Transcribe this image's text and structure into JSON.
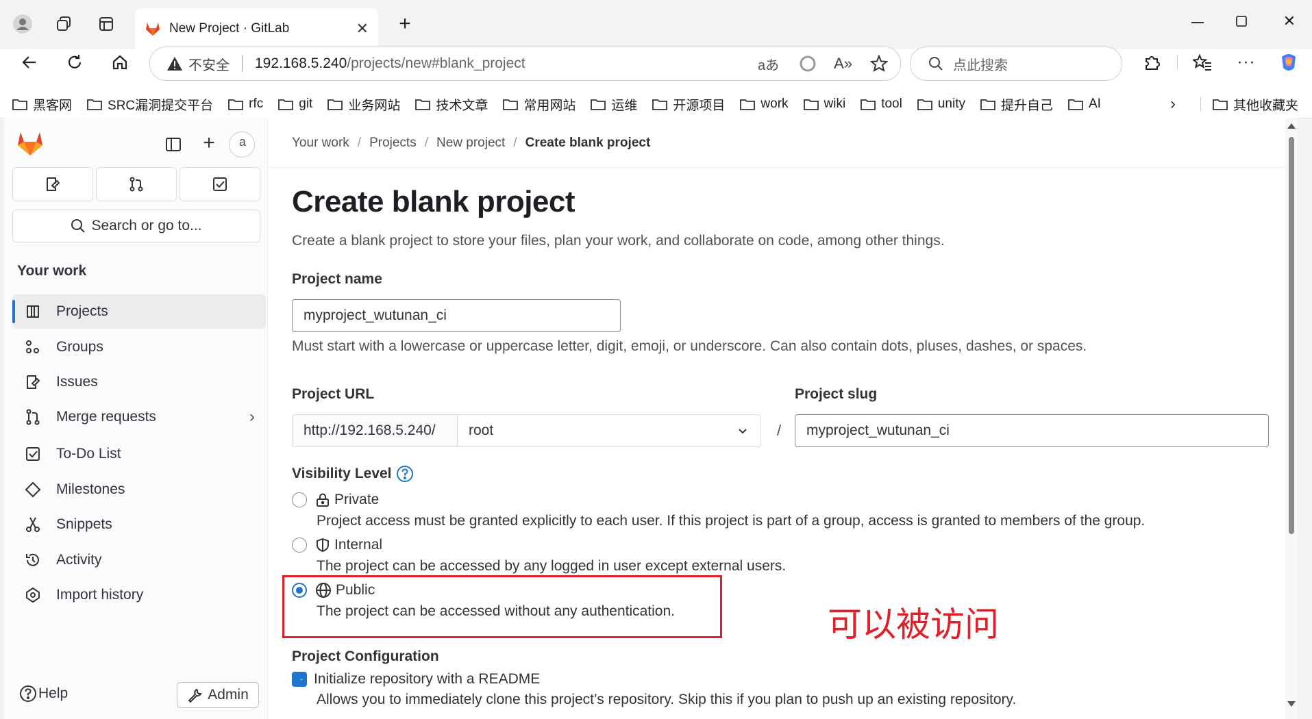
{
  "browser": {
    "tab_title": "New Project · GitLab",
    "insecure_label": "不安全",
    "url_host": "192.168.5.240",
    "url_path": "/projects/new#blank_project",
    "search_placeholder": "点此搜索",
    "bookmarks": [
      "黑客网",
      "SRC漏洞提交平台",
      "rfc",
      "git",
      "业务网站",
      "技术文章",
      "常用网站",
      "运维",
      "开源项目",
      "work",
      "wiki",
      "tool",
      "unity",
      "提升自己",
      "AI"
    ],
    "other_bookmarks": "其他收藏夹"
  },
  "sidebar": {
    "search_label": "Search or go to...",
    "section_title": "Your work",
    "items": [
      {
        "label": "Projects",
        "icon": "project-icon"
      },
      {
        "label": "Groups",
        "icon": "group-icon"
      },
      {
        "label": "Issues",
        "icon": "issues-icon"
      },
      {
        "label": "Merge requests",
        "icon": "merge-request-icon"
      },
      {
        "label": "To-Do List",
        "icon": "todo-icon"
      },
      {
        "label": "Milestones",
        "icon": "milestone-icon"
      },
      {
        "label": "Snippets",
        "icon": "snippet-icon"
      },
      {
        "label": "Activity",
        "icon": "history-icon"
      },
      {
        "label": "Import history",
        "icon": "import-icon"
      }
    ],
    "help_label": "Help",
    "admin_label": "Admin",
    "avatar_alt": "a"
  },
  "breadcrumb": [
    "Your work",
    "Projects",
    "New project",
    "Create blank project"
  ],
  "page": {
    "title": "Create blank project",
    "subtitle": "Create a blank project to store your files, plan your work, and collaborate on code, among other things.",
    "project_name_label": "Project name",
    "project_name_value": "myproject_wutunan_ci",
    "project_name_help": "Must start with a lowercase or uppercase letter, digit, emoji, or underscore. Can also contain dots, pluses, dashes, or spaces.",
    "project_url_label": "Project URL",
    "project_url_prefix": "http://192.168.5.240/",
    "namespace_value": "root",
    "slash": "/",
    "project_slug_label": "Project slug",
    "project_slug_value": "myproject_wutunan_ci",
    "visibility_label": "Visibility Level",
    "visibility": [
      {
        "label": "Private",
        "desc": "Project access must be granted explicitly to each user. If this project is part of a group, access is granted to members of the group.",
        "selected": false
      },
      {
        "label": "Internal",
        "desc": "The project can be accessed by any logged in user except external users.",
        "selected": false
      },
      {
        "label": "Public",
        "desc": "The project can be accessed without any authentication.",
        "selected": true
      }
    ],
    "annotation": "可以被访问",
    "config_label": "Project Configuration",
    "readme_label": "Initialize repository with a README",
    "readme_desc": "Allows you to immediately clone this project’s repository. Skip this if you plan to push up an existing repository."
  },
  "colors": {
    "accent": "#1f75cb",
    "annotation_red": "#e0202a",
    "gitlab_orange": "#fc6d26"
  }
}
